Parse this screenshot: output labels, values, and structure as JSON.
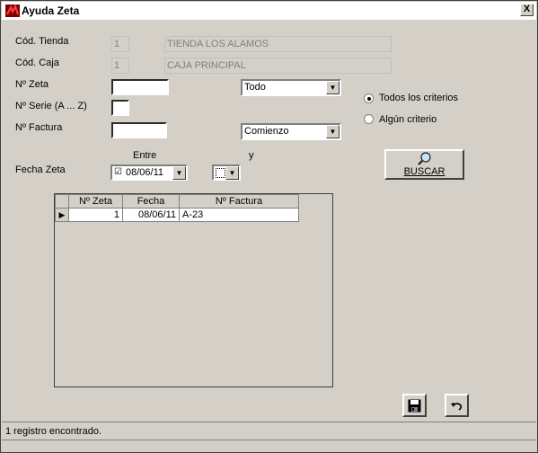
{
  "window": {
    "title": "Ayuda Zeta",
    "close_label": "X"
  },
  "form": {
    "tienda_label": "Cód. Tienda",
    "tienda_code": "1",
    "tienda_name": "TIENDA LOS ALAMOS",
    "caja_label": "Cód. Caja",
    "caja_code": "1",
    "caja_name": "CAJA PRINCIPAL",
    "zeta_label": "Nº Zeta",
    "zeta_value": "",
    "zeta_combo": "Todo",
    "serie_label": "Nº Serie (A ... Z)",
    "serie_value": "",
    "factura_label": "Nº Factura",
    "factura_value": "",
    "factura_combo": "Comienzo",
    "entre_label": "Entre",
    "y_label": "y",
    "fecha_label": "Fecha Zeta",
    "fecha_desde": "08/06/11",
    "fecha_desde_checked": "☑"
  },
  "criteria": {
    "todos": "Todos los criterios",
    "alguno": "Algún criterio",
    "selected": "todos"
  },
  "search_button": "BUSCAR",
  "grid": {
    "headers": [
      "Nº Zeta",
      "Fecha",
      "Nº Factura"
    ],
    "rows": [
      {
        "zeta": "1",
        "fecha": "08/06/11",
        "factura": "A-23"
      }
    ]
  },
  "status": "1 registro encontrado.",
  "colors": {
    "accent": "#000080",
    "face": "#d4d0c8"
  }
}
